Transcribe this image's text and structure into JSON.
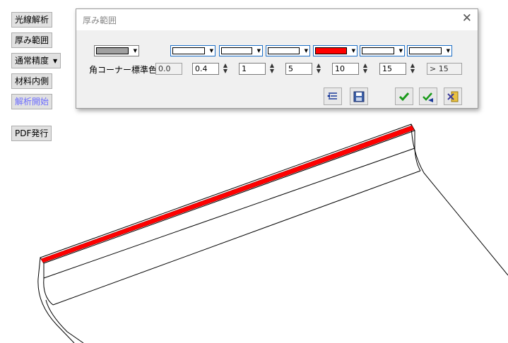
{
  "sidebar": {
    "items": [
      {
        "label": "光線解析"
      },
      {
        "label": "厚み範囲"
      },
      {
        "label": "通常精度",
        "dropdown_glyph": "▼"
      },
      {
        "label": "材料内側"
      },
      {
        "label": "解析開始",
        "state": "disabled"
      },
      {
        "label": "PDF発行"
      }
    ]
  },
  "dialog": {
    "title": "厚み範囲",
    "close_glyph": "✕",
    "corner_label": "角コーナー標準色",
    "default_color": "#a0a0a0",
    "range_colors": [
      "#ffffff",
      "#ffffff",
      "#ffffff",
      "#ff0000",
      "#ffffff",
      "#ffffff"
    ],
    "thresholds": [
      "0.0",
      "0.4",
      "1",
      "5",
      "10",
      "15"
    ],
    "over_label": "> 15",
    "buttons": {
      "reset": "reset-list-icon",
      "save": "save-icon",
      "ok": "check-icon",
      "apply": "apply-check-icon",
      "cancel": "cancel-exit-icon"
    }
  },
  "model": {
    "highlight_color": "#ff0000",
    "edge_color": "#000000"
  }
}
